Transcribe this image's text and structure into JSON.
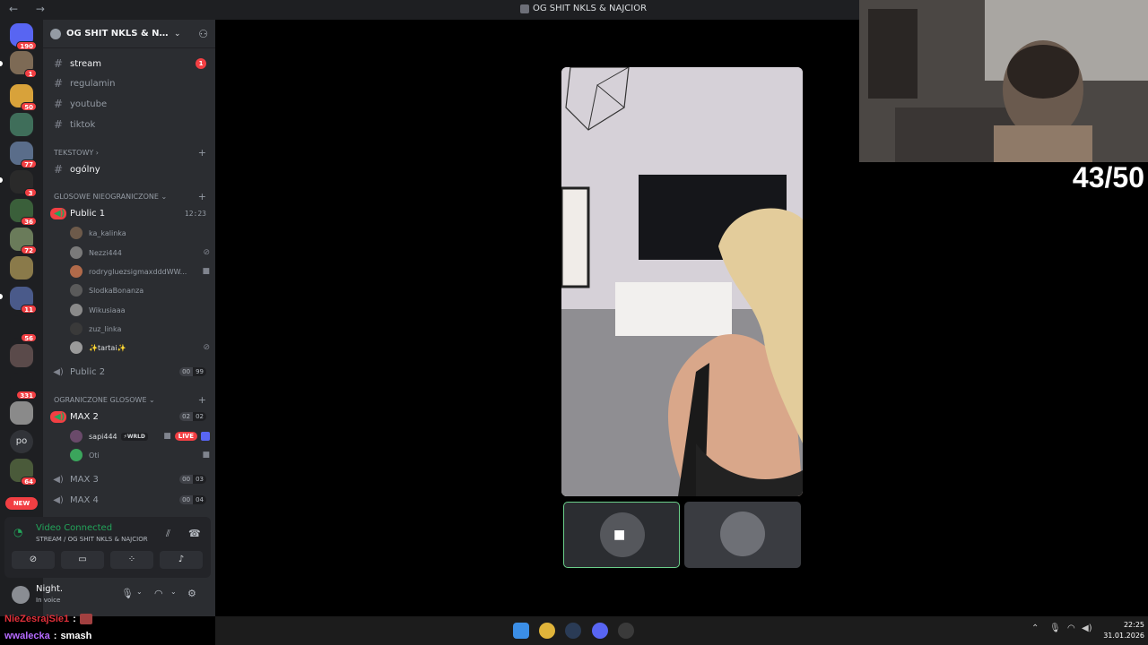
{
  "titlebar": {
    "nav": "← →",
    "window_title": "OG SHIT NKLS & NAJCIOR"
  },
  "server_badges": [
    "190",
    "1",
    "50",
    "77",
    "3",
    "36",
    "72",
    "11",
    "56",
    "331",
    "64"
  ],
  "server_text_icons": {
    "po": "po"
  },
  "new_pill": "NEW",
  "server": {
    "name": "OG SHIT NKLS & NAJCIOR"
  },
  "channels": {
    "stream": {
      "label": "stream",
      "unread": "1"
    },
    "regulamin": {
      "label": "regulamin"
    },
    "youtube": {
      "label": "youtube"
    },
    "tiktok": {
      "label": "tiktok"
    },
    "cat_text": "TEKSTOWY",
    "ogolny": {
      "label": "ogólny"
    },
    "cat_voice_unlimited": "GLOSOWE NIEOGRANICZONE",
    "public1": {
      "label": "Public 1",
      "timer": "12:23"
    },
    "public2": {
      "label": "Public 2",
      "limit_a": "00",
      "limit_b": "99"
    },
    "cat_voice_limited": "OGRANICZONE GLOSOWE",
    "max2": {
      "label": "MAX 2",
      "limit_a": "02",
      "limit_b": "02"
    },
    "max3": {
      "label": "MAX 3",
      "limit_a": "00",
      "limit_b": "03"
    },
    "max4": {
      "label": "MAX 4",
      "limit_a": "00",
      "limit_b": "04"
    }
  },
  "voice_users_public1": [
    "ka_kalinka",
    "Nezzi444",
    "rodrygluezsigmaxdddWW...",
    "SlodkaBonanza",
    "Wikusiaaa",
    "zuz_linka",
    "✨tartai✨"
  ],
  "voice_users_max2": {
    "sapi": "sapi444",
    "sapi_tag": "⚡WRLD",
    "sapi_live": "LIVE",
    "oti": "Oti"
  },
  "voice_panel": {
    "status": "Video Connected",
    "sub": "STREAM / OG SHIT NKLS & NAJCIOR"
  },
  "user_panel": {
    "name": "Night.",
    "status": "In voice"
  },
  "overlay": {
    "counter": "43/50"
  },
  "chat": [
    {
      "user": "NieZesrajSie1",
      "sep": ":",
      "msg": ""
    },
    {
      "user": "wwalecka",
      "sep": ":",
      "msg": "smash"
    }
  ],
  "clock": {
    "time": "22:25",
    "date": "31.01.2026"
  },
  "colors": {
    "accent_green": "#23a55a",
    "badge_red": "#f23f43",
    "blurple": "#5865f2"
  }
}
